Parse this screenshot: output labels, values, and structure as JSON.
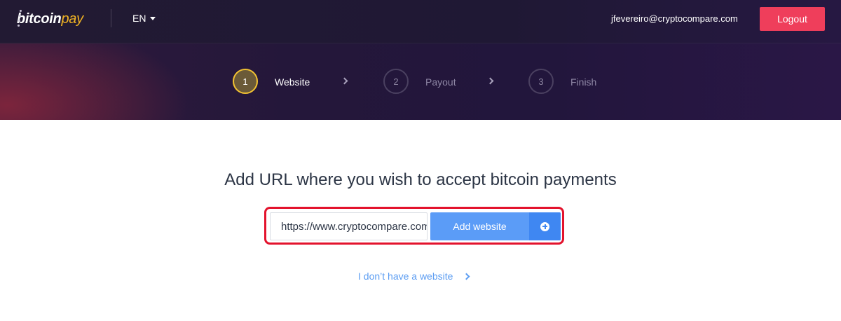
{
  "header": {
    "logo": {
      "part1": "bitcoin",
      "part2": "pay"
    },
    "language": "EN",
    "user_email": "jfevereiro@cryptocompare.com",
    "logout_label": "Logout"
  },
  "steps": [
    {
      "number": "1",
      "label": "Website",
      "active": true
    },
    {
      "number": "2",
      "label": "Payout",
      "active": false
    },
    {
      "number": "3",
      "label": "Finish",
      "active": false
    }
  ],
  "main": {
    "headline": "Add URL where you wish to accept bitcoin payments",
    "url_value": "https://www.cryptocompare.com",
    "add_button_label": "Add website",
    "add_button_icon": "plus-circle-icon",
    "no_website_link": "I don’t have a website"
  },
  "colors": {
    "accent_red": "#ef3e5b",
    "step_active_ring": "#f2c232",
    "button_blue": "#5b9cf7",
    "button_blue_dark": "#3f87f2",
    "link_blue": "#5c9df2",
    "highlight_outline": "#e3132d"
  }
}
